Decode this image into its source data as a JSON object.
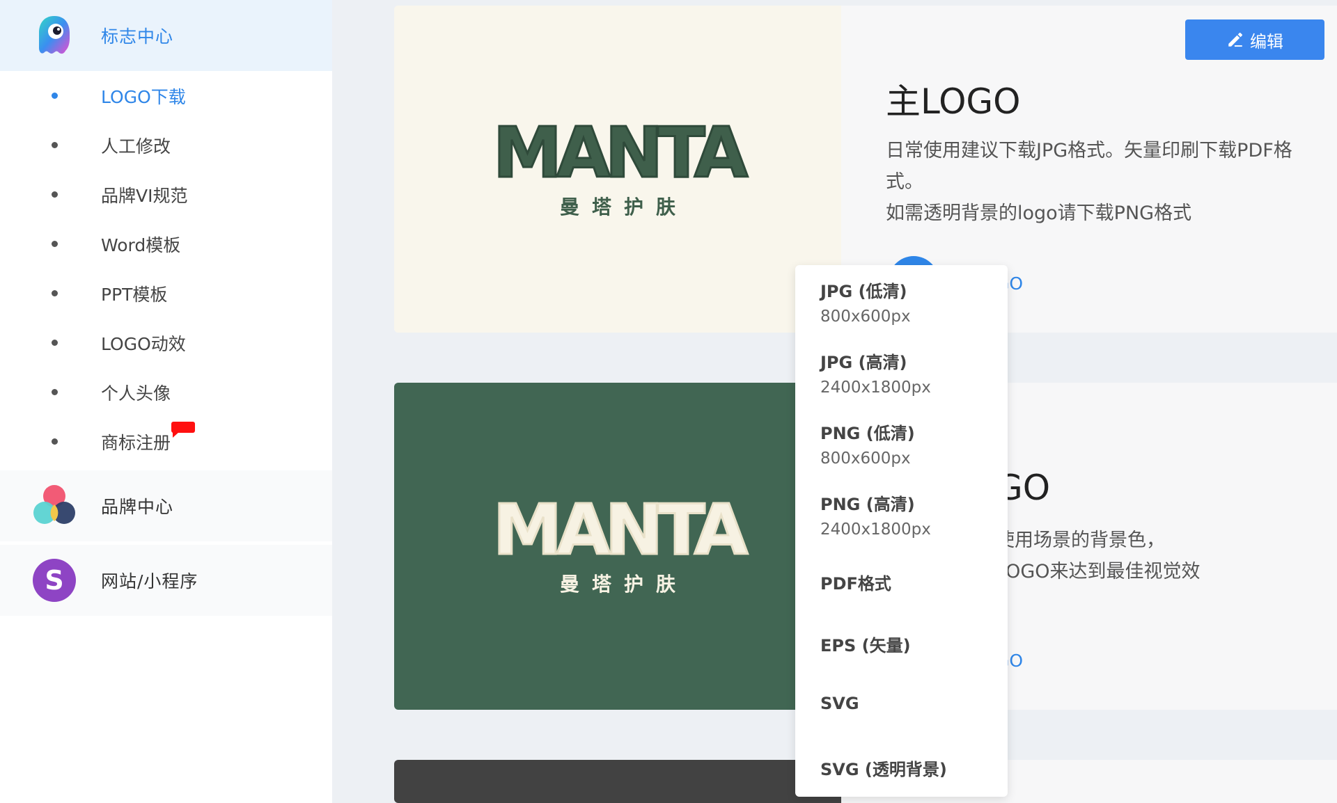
{
  "sidebar": {
    "groups": [
      {
        "label": "标志中心",
        "icon": "mascot-icon"
      },
      {
        "label": "品牌中心",
        "icon": "color-circles-icon"
      },
      {
        "label": "网站/小程序",
        "icon": "letter-s-icon",
        "icon_text": "S"
      }
    ],
    "sub_items": [
      {
        "label": "LOGO下载",
        "active": true
      },
      {
        "label": "人工修改"
      },
      {
        "label": "品牌VI规范"
      },
      {
        "label": "Word模板"
      },
      {
        "label": "PPT模板"
      },
      {
        "label": "LOGO动效"
      },
      {
        "label": "个人头像"
      },
      {
        "label": "商标注册",
        "badge": "new-badge"
      }
    ]
  },
  "toolbar": {
    "edit_label": "编辑",
    "edit_icon": "pencil-icon"
  },
  "cards": [
    {
      "brand": "MANTA",
      "brand_sub": "曼塔护肤",
      "preview_bg": "#f9f6ec",
      "brand_color": "#3f5f4b",
      "title": "主LOGO",
      "desc_line1": "日常使用建议下载JPG格式。矢量印刷下载PDF格式。",
      "desc_line2": "如需透明背景的logo请下载PNG格式",
      "download_visible": "GO"
    },
    {
      "brand": "MANTA",
      "brand_sub": "曼塔护肤",
      "preview_bg": "#416653",
      "brand_color": "#f7f2e3",
      "title_visible": "GO",
      "desc_line1_visible": "使用场景的背景色，",
      "desc_line2_visible": "LOGO来达到最佳视觉效",
      "download_visible": "GO"
    },
    {
      "preview_bg": "#424242"
    }
  ],
  "dropdown": {
    "items": [
      {
        "label": "JPG (低清)",
        "size": "800x600px"
      },
      {
        "label": "JPG (高清)",
        "size": "2400x1800px"
      },
      {
        "label": "PNG (低清)",
        "size": "800x600px"
      },
      {
        "label": "PNG (高清)",
        "size": "2400x1800px"
      },
      {
        "label": "PDF格式"
      },
      {
        "label": "EPS (矢量)"
      },
      {
        "label": "SVG"
      },
      {
        "label": "SVG (透明背景)"
      }
    ]
  },
  "colors": {
    "accent": "#2f86e8",
    "badge": "#ff1010",
    "active_bg": "#eaf3fc"
  }
}
